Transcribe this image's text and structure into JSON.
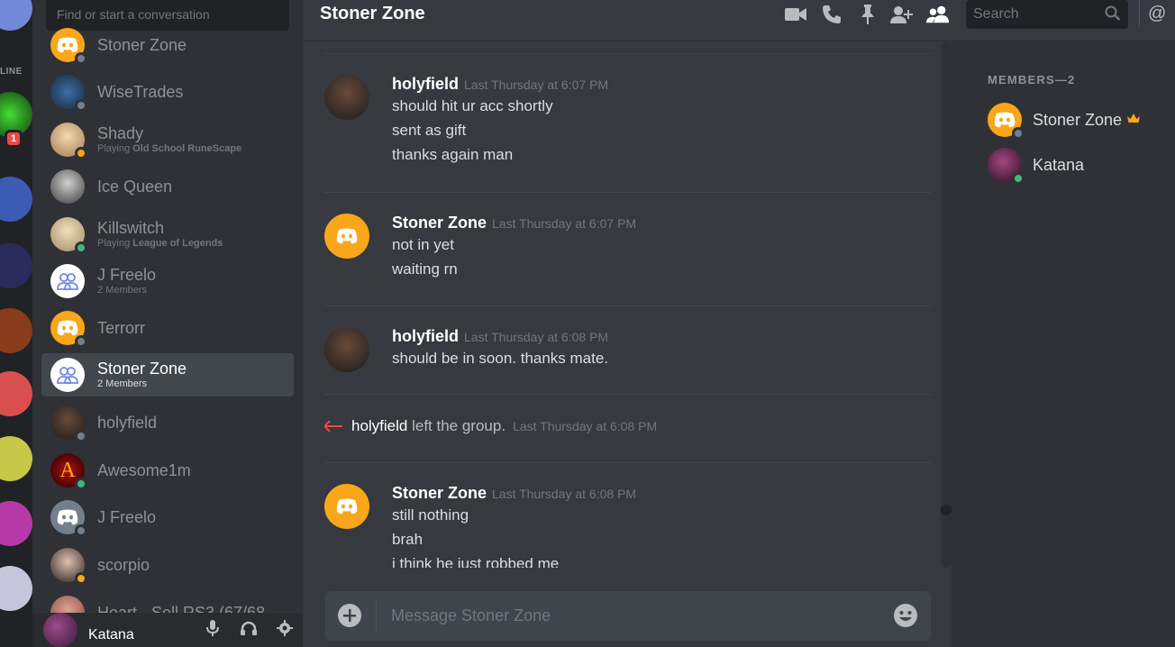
{
  "server_rail": {
    "online_label": "LINE",
    "badge_count": "1",
    "servers": [
      {
        "color": "#7289da"
      },
      {
        "color": "#2a6b1a"
      },
      {
        "color": "#3b5bb5"
      },
      {
        "color": "#2a2a5c"
      },
      {
        "color": "#8a3b1a"
      },
      {
        "color": "#d94f4f"
      },
      {
        "color": "#c7c74a"
      },
      {
        "color": "#b53aa8"
      },
      {
        "color": "#c6c6dd"
      }
    ]
  },
  "dm_sidebar": {
    "search_placeholder": "Find or start a conversation",
    "items": [
      {
        "name": "Stoner Zone",
        "sub": "",
        "status": "offline",
        "avatar": "clyde-orange"
      },
      {
        "name": "WiseTrades",
        "sub": "",
        "status": "offline",
        "avatar": "wise"
      },
      {
        "name": "Shady",
        "sub_prefix": "Playing ",
        "sub_game": "Old School RuneScape",
        "status": "idle",
        "avatar": "photo"
      },
      {
        "name": "Ice Queen",
        "sub": "",
        "status": "none",
        "avatar": "photo-gray"
      },
      {
        "name": "Killswitch",
        "sub_prefix": "Playing ",
        "sub_game": "League of Legends",
        "status": "online",
        "avatar": "anime"
      },
      {
        "name": "J Freelo",
        "sub": "2 Members",
        "status": "none",
        "avatar": "group"
      },
      {
        "name": "Terrorr",
        "sub": "",
        "status": "offline",
        "avatar": "clyde-orange"
      },
      {
        "name": "Stoner Zone",
        "sub": "2 Members",
        "status": "none",
        "avatar": "group",
        "active": true
      },
      {
        "name": "holyfield",
        "sub": "",
        "status": "offline",
        "avatar": "boxer"
      },
      {
        "name": "Awesome1m",
        "sub": "",
        "status": "online",
        "avatar": "letter-a"
      },
      {
        "name": "J Freelo",
        "sub": "",
        "status": "offline",
        "avatar": "clyde-gray"
      },
      {
        "name": "scorpio",
        "sub": "",
        "status": "idle",
        "avatar": "photo-dark"
      },
      {
        "name": "Heart - Sell RS3 (67/68",
        "sub": "",
        "status": "none",
        "avatar": "photo-pink"
      }
    ]
  },
  "user_panel": {
    "username": "Katana"
  },
  "header": {
    "title": "Stoner Zone",
    "search_placeholder": "Search",
    "mention_symbol": "@"
  },
  "messages": [
    {
      "author": "holyfield",
      "timestamp": "Last Thursday at 6:07 PM",
      "avatar": "boxer",
      "lines": [
        "should hit ur acc shortly",
        "sent as gift",
        "thanks again man"
      ]
    },
    {
      "author": "Stoner Zone",
      "timestamp": "Last Thursday at 6:07 PM",
      "avatar": "clyde-orange",
      "lines": [
        "not in yet",
        "waiting rn"
      ]
    },
    {
      "author": "holyfield",
      "timestamp": "Last Thursday at 6:08 PM",
      "avatar": "boxer",
      "lines": [
        "should be in soon. thanks mate."
      ]
    },
    {
      "author": "Stoner Zone",
      "timestamp": "Last Thursday at 6:08 PM",
      "avatar": "clyde-orange",
      "lines": [
        "still nothing",
        "brah",
        "i think he just robbed me"
      ]
    }
  ],
  "system_message": {
    "who": "holyfield",
    "text": " left the group.",
    "timestamp": "Last Thursday at 6:08 PM"
  },
  "composer": {
    "placeholder": "Message Stoner Zone"
  },
  "members": {
    "header": "MEMBERS—2",
    "list": [
      {
        "name": "Stoner Zone",
        "status": "offline",
        "owner": true
      },
      {
        "name": "Katana",
        "status": "online",
        "owner": false
      }
    ]
  },
  "colors": {
    "accent_orange": "#faa61a",
    "blurple": "#7289da",
    "online": "#43b581",
    "offline": "#747f8d",
    "danger": "#f04747"
  }
}
